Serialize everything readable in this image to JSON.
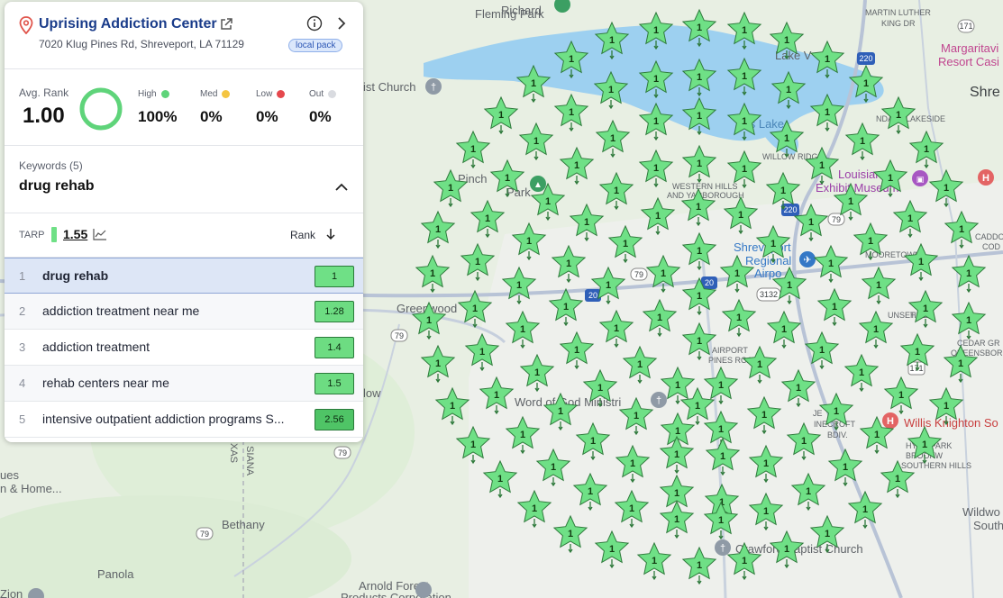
{
  "map": {
    "labels": {
      "fleming_park": "Fleming Park",
      "richard": "Richard",
      "martin_luther_king": "MARTIN LUTHER",
      "king_dr": "KING DR",
      "margaritaville": "Margaritavi",
      "resort_casino": "Resort Casi",
      "shreveport_edge": "Shre",
      "lake": "Lake V",
      "church_left": "ist Church",
      "cross_lake": "oss Lake",
      "willow_ridge": "WILLOW RIDG",
      "ndale_lakeside": "NDALE-LAKESIDE",
      "pinchok_park": "Pinch",
      "park": "Park",
      "western_hills": "WESTERN HILLS",
      "yarborough": "AND YARBOROUGH",
      "louisiana": "Louisiana",
      "exhibit_museum": "Exhibit Museum",
      "shreveport_regional": "Shreveport",
      "regional": "Regional",
      "airport": "Airpo",
      "moortown": "MOORETOWN",
      "greenwood": "Greenwood",
      "sunset_acres": "UNSET",
      "hills": "HILLS",
      "cedar_grove": "CEDAR GR",
      "queensborough": "QUEENSBOR",
      "airport_pines": "AIRPORT",
      "pines_road": "PINES ROAD",
      "word_of_god": "Word of God Ministri",
      "low": "low",
      "willis_knighton": "Willis Knighton So",
      "jewella": "JE",
      "inecroft": "INECROFT",
      "bdiv": "BDIV.",
      "hyde_park": "HYDE PARK",
      "brookwood": "BROOKW",
      "southern_hills": "SOUTHERN HILLS",
      "siana": "SIANA",
      "xas": "XAS",
      "ues": "ues",
      "home": "n & Home...",
      "bethany": "Bethany",
      "panola": "Panola",
      "arnold_forest": "Arnold Forest",
      "products_corp": "Products Corporation",
      "crawford_church": "Crawford Baptist Church",
      "wildwood": "Wildwo",
      "south": "South",
      "zion": "Zion",
      "cadd": "CADDO",
      "cod": "COD",
      "rte_171": "171",
      "rte_220": "220",
      "rte_79": "79",
      "rte_20": "20",
      "rte_3132": "3132"
    },
    "pin_rank": "1",
    "pin_color": "#6fe086"
  },
  "business": {
    "name": "Uprising Addiction Center",
    "address": "7020 Klug Pines Rd, Shreveport, LA 71129",
    "badge": "local pack"
  },
  "stats": {
    "avg_label": "Avg. Rank",
    "avg_value": "1.00",
    "ring_fraction": 1.0,
    "high_label": "High",
    "high_value": "100%",
    "high_color": "#5fd47a",
    "med_label": "Med",
    "med_value": "0%",
    "med_color": "#f4c542",
    "low_label": "Low",
    "low_value": "0%",
    "low_color": "#e5484d",
    "out_label": "Out",
    "out_value": "0%",
    "out_color": "#d9dbe0"
  },
  "keywords": {
    "label": "Keywords (5)",
    "selected": "drug rehab"
  },
  "tarp": {
    "label": "TARP",
    "value": "1.55",
    "rank_label": "Rank"
  },
  "keyword_rows": [
    {
      "num": "1",
      "text": "drug rehab",
      "rank": "1",
      "color": "#6fe086"
    },
    {
      "num": "2",
      "text": "addiction treatment near me",
      "rank": "1.28",
      "color": "#6ddc82"
    },
    {
      "num": "3",
      "text": "addiction treatment",
      "rank": "1.4",
      "color": "#6ddc82"
    },
    {
      "num": "4",
      "text": "rehab centers near me",
      "rank": "1.5",
      "color": "#6ddc82"
    },
    {
      "num": "5",
      "text": "intensive outpatient addiction programs S...",
      "rank": "2.56",
      "color": "#4fc466"
    }
  ]
}
